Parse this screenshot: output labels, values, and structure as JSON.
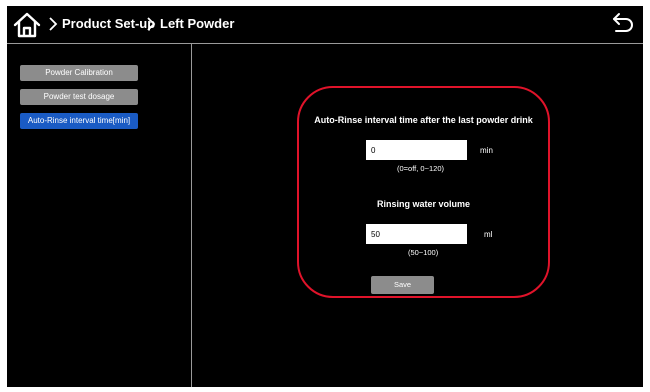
{
  "header": {
    "home_icon": "home-icon",
    "breadcrumb": [
      "Product Set-up",
      "Left Powder"
    ],
    "back_icon": "back-arrow-icon"
  },
  "sidebar": {
    "items": [
      {
        "label": "Powder Calibration",
        "active": false
      },
      {
        "label": "Powder test dosage",
        "active": false
      },
      {
        "label": "Auto-Rinse interval time[min]",
        "active": true
      }
    ]
  },
  "panel": {
    "interval": {
      "title": "Auto-Rinse interval time after the last powder drink",
      "value": "0",
      "unit": "min",
      "hint": "(0=off, 0~120)"
    },
    "volume": {
      "title": "Rinsing water volume",
      "value": "50",
      "unit": "ml",
      "hint": "(50~100)"
    },
    "save_label": "Save"
  },
  "colors": {
    "background": "#000000",
    "button_gray": "#8c8c8c",
    "button_active": "#1a5bc4",
    "highlight_border": "#e0132a",
    "text": "#ffffff"
  }
}
